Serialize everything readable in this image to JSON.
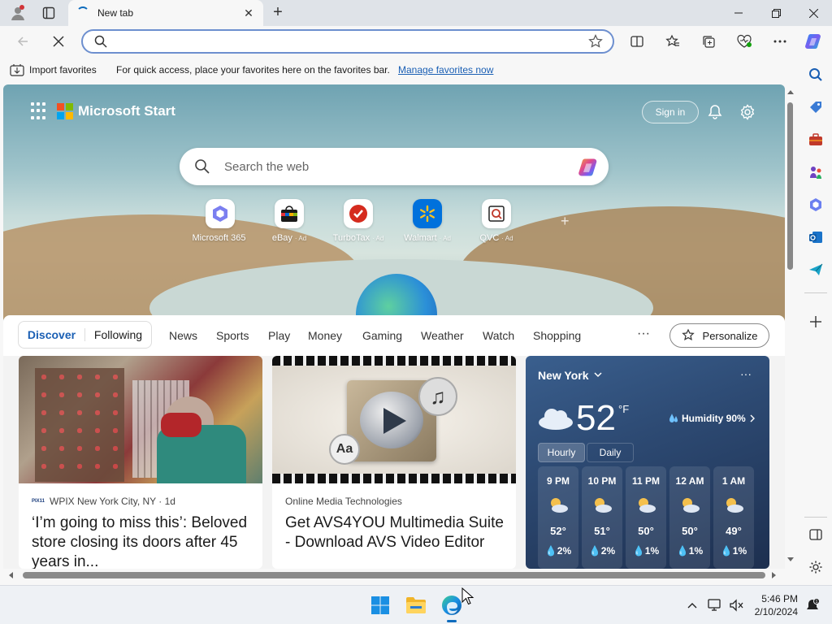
{
  "browser": {
    "tab_title": "New tab",
    "address_value": "",
    "address_placeholder": "",
    "favbar": {
      "import_label": "Import favorites",
      "hint": "For quick access, place your favorites here on the favorites bar.",
      "manage_link": "Manage favorites now"
    }
  },
  "start": {
    "brand": "Microsoft Start",
    "signin": "Sign in",
    "search_placeholder": "Search the web",
    "quicklinks": [
      {
        "label": "Microsoft 365",
        "ad": ""
      },
      {
        "label": "eBay",
        "ad": "· Ad"
      },
      {
        "label": "TurboTax",
        "ad": "· Ad"
      },
      {
        "label": "Walmart",
        "ad": "· Ad"
      },
      {
        "label": "QVC",
        "ad": "· Ad"
      }
    ],
    "add_site": "+"
  },
  "feed": {
    "toggle": [
      "Discover",
      "Following"
    ],
    "tabs": [
      "News",
      "Sports",
      "Play",
      "Money",
      "Gaming",
      "Weather",
      "Watch",
      "Shopping"
    ],
    "more": "···",
    "personalize": "Personalize",
    "cards": [
      {
        "source_logo": "PIX11",
        "source": "WPIX New York City, NY · 1d",
        "title": "‘I’m going to miss this’: Beloved store closing its doors after 45 years in..."
      },
      {
        "source": "Online Media Technologies",
        "title": "Get AVS4YOU Multimedia Suite - Download AVS Video Editor",
        "badge_text": "Aa"
      }
    ]
  },
  "weather": {
    "city": "New York",
    "more": "···",
    "temp": "52",
    "unit": "°F",
    "humidity": "Humidity 90%",
    "tabs": [
      "Hourly",
      "Daily"
    ],
    "hours": [
      {
        "time": "9 PM",
        "temp": "52°",
        "rain": "2%"
      },
      {
        "time": "10 PM",
        "temp": "51°",
        "rain": "2%"
      },
      {
        "time": "11 PM",
        "temp": "50°",
        "rain": "1%"
      },
      {
        "time": "12 AM",
        "temp": "50°",
        "rain": "1%"
      },
      {
        "time": "1 AM",
        "temp": "49°",
        "rain": "1%"
      }
    ]
  },
  "taskbar": {
    "time": "5:46 PM",
    "date": "2/10/2024"
  },
  "colors": {
    "accent": "#0f6cbd",
    "discover": "#1a5fb4",
    "weather_bg": "#2d4a73"
  }
}
